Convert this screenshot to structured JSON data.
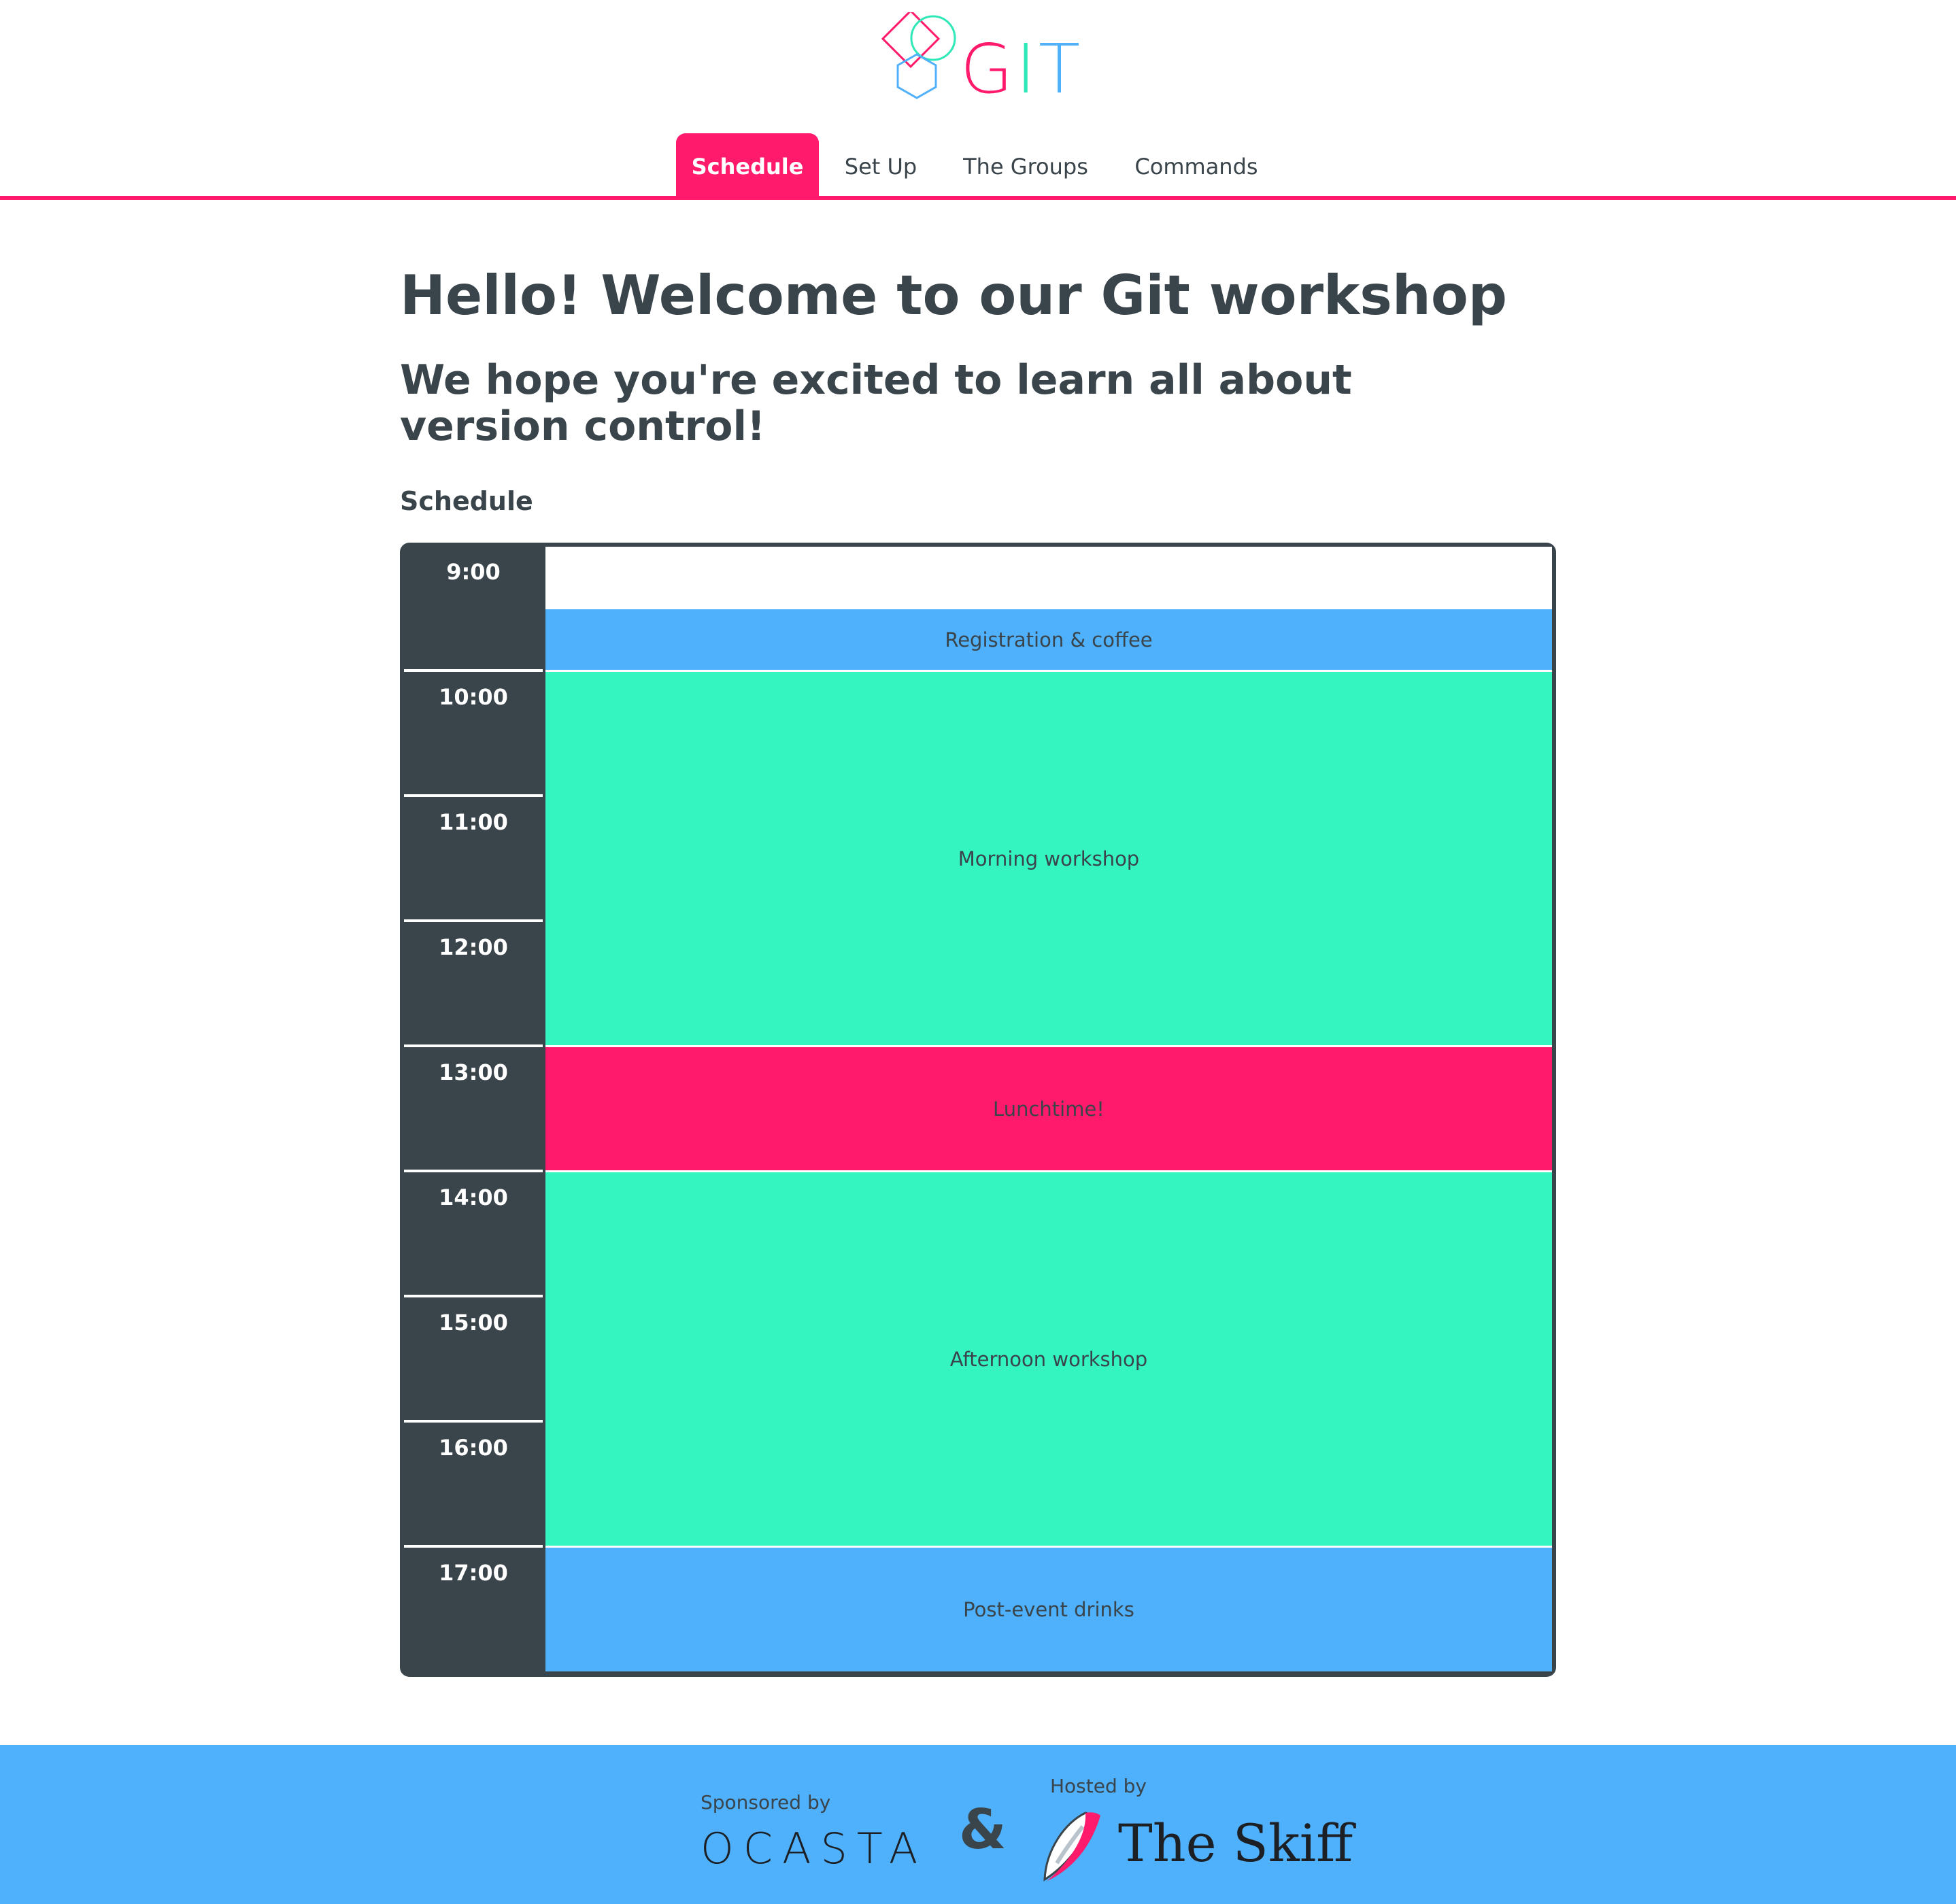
{
  "brand": {
    "logo_letters": [
      "G",
      "I",
      "T"
    ],
    "colors": {
      "pink": "#ff1a6b",
      "green": "#34f5c0",
      "blue": "#4fb0fb",
      "dark": "#3a444b"
    }
  },
  "nav": {
    "tabs": [
      {
        "label": "Schedule",
        "active": true
      },
      {
        "label": "Set Up",
        "active": false
      },
      {
        "label": "The Groups",
        "active": false
      },
      {
        "label": "Commands",
        "active": false
      }
    ]
  },
  "main": {
    "title": "Hello! Welcome to our Git workshop",
    "subtitle": "We hope you're excited to learn all about version control!",
    "section_heading": "Schedule"
  },
  "schedule": {
    "times": [
      "9:00",
      "10:00",
      "11:00",
      "12:00",
      "13:00",
      "14:00",
      "15:00",
      "16:00",
      "17:00"
    ],
    "events": [
      {
        "label": "Registration & coffee",
        "start": "9:30",
        "end": "10:00",
        "color": "#4fb0fb"
      },
      {
        "label": "Morning workshop",
        "start": "10:00",
        "end": "13:00",
        "color": "#34f5c0"
      },
      {
        "label": "Lunchtime!",
        "start": "13:00",
        "end": "14:00",
        "color": "#ff1a6b"
      },
      {
        "label": "Afternoon workshop",
        "start": "14:00",
        "end": "17:00",
        "color": "#34f5c0"
      },
      {
        "label": "Post-event drinks",
        "start": "17:00",
        "end": "18:00",
        "color": "#4fb0fb"
      }
    ]
  },
  "footer": {
    "sponsored_label": "Sponsored by",
    "sponsor_name": "OCASTA",
    "ampersand": "&",
    "hosted_label": "Hosted by",
    "host_name": "The Skiff"
  }
}
